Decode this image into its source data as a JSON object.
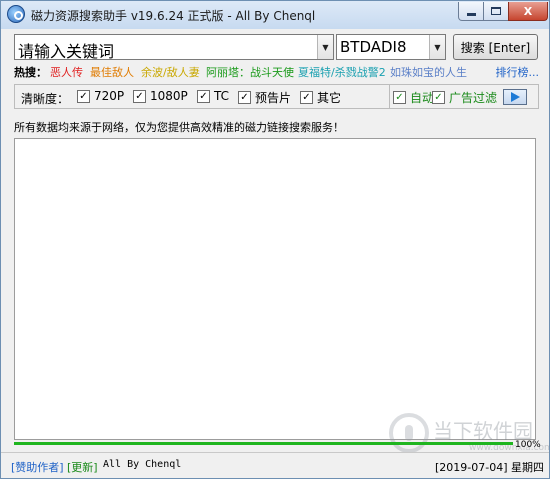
{
  "window": {
    "title": "磁力资源搜索助手 v19.6.24 正式版 - All By Chenql",
    "min_label": "",
    "close_label": "X"
  },
  "search": {
    "keyword_value": "请输入关键词",
    "engine_value": "BTDADI8",
    "button_label": "搜索 [Enter]"
  },
  "hot": {
    "label": "热搜：",
    "items": [
      {
        "text": "恶人传",
        "color": "#e02020"
      },
      {
        "text": "最佳敌人",
        "color": "#e07b00"
      },
      {
        "text": "余波/敌人妻",
        "color": "#c9a800"
      },
      {
        "text": "阿丽塔：战斗天使",
        "color": "#1a9a1a"
      },
      {
        "text": "夏福特/杀戮战警2",
        "color": "#1aa0b0"
      },
      {
        "text": "如珠如宝的人生",
        "color": "#5a7fc7"
      }
    ],
    "rank_link": "排行榜..."
  },
  "options": {
    "clarity_label": "清晰度：",
    "checkboxes": [
      {
        "label": "720P",
        "checked": "✓"
      },
      {
        "label": "1080P",
        "checked": "✓"
      },
      {
        "label": "TC",
        "checked": "✓"
      },
      {
        "label": "预告片",
        "checked": "✓"
      },
      {
        "label": "其它",
        "checked": "✓"
      }
    ],
    "auto_label": "自动",
    "adfilter_label": "广告过滤",
    "auto_checked": "✓",
    "adfilter_checked": "✓"
  },
  "info_text": "所有数据均来源于网络，仅为您提供高效精准的磁力链接搜索服务！",
  "progress": {
    "text": "100%",
    "value": 1.0
  },
  "watermark": {
    "text": "当下软件园",
    "sub": "www.downxia.com"
  },
  "status": {
    "sponsor": "[赞助作者]",
    "update": "[更新]",
    "author": "All By Chenql",
    "date": "[2019-07-04] 星期四"
  }
}
